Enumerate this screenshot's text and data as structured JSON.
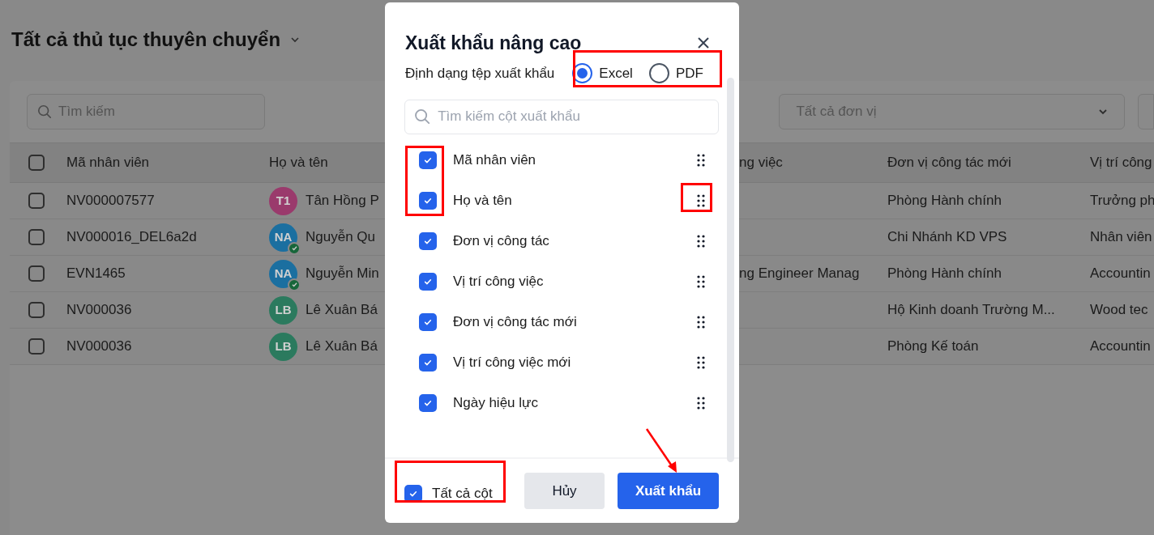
{
  "page": {
    "title": "Tất cả thủ tục thuyên chuyển",
    "search": {
      "placeholder": "Tìm kiếm"
    },
    "unit_filter": {
      "placeholder": "Tất cả đơn vị"
    }
  },
  "table": {
    "header_checked": false,
    "columns": [
      "Mã nhân viên",
      "Họ và tên",
      "ng việc",
      "Đơn vị công tác mới",
      "Vị trí công"
    ],
    "rows": [
      {
        "checked": false,
        "code": "NV000007577",
        "avatar": {
          "initials": "T1",
          "color": "#9a3a6c",
          "verified": false
        },
        "name": "Tân Hồng P",
        "column_3": "",
        "new_unit": "Phòng Hành chính",
        "column_5": "Trưởng ph"
      },
      {
        "checked": false,
        "code": "NV000016_DEL6a2d",
        "avatar": {
          "initials": "NA",
          "color": "#1b6fa0",
          "verified": true
        },
        "name": "Nguyễn Qu",
        "column_3": "",
        "new_unit": "Chi Nhánh KD VPS",
        "column_5": "Nhân viên"
      },
      {
        "checked": false,
        "code": "EVN1465",
        "avatar": {
          "initials": "NA",
          "color": "#1b6fa0",
          "verified": true
        },
        "name": "Nguyễn Min",
        "column_3": "ng Engineer Manag",
        "new_unit": "Phòng Hành chính",
        "column_5": "Accountin"
      },
      {
        "checked": false,
        "code": "NV000036",
        "avatar": {
          "initials": "LB",
          "color": "#2b7a5e",
          "verified": false
        },
        "name": "Lê Xuân Bá",
        "column_3": "",
        "new_unit": "Hộ Kinh doanh Trường M...",
        "column_5": "Wood tec"
      },
      {
        "checked": false,
        "code": "NV000036",
        "avatar": {
          "initials": "LB",
          "color": "#2b7a5e",
          "verified": false
        },
        "name": "Lê Xuân Bá",
        "column_3": "",
        "new_unit": "Phòng Kế toán",
        "column_5": "Accountin"
      }
    ]
  },
  "dialog": {
    "title": "Xuất khẩu nâng cao",
    "format_label": "Định dạng tệp xuất khẩu",
    "formats": [
      {
        "label": "Excel",
        "selected": true
      },
      {
        "label": "PDF",
        "selected": false
      }
    ],
    "search": {
      "placeholder": "Tìm kiếm cột xuất khẩu"
    },
    "columns": [
      {
        "label": "Mã nhân viên",
        "checked": true
      },
      {
        "label": "Họ và tên",
        "checked": true
      },
      {
        "label": "Đơn vị công tác",
        "checked": true
      },
      {
        "label": "Vị trí công việc",
        "checked": true
      },
      {
        "label": "Đơn vị công tác mới",
        "checked": true
      },
      {
        "label": "Vị trí công việc mới",
        "checked": true
      },
      {
        "label": "Ngày hiệu lực",
        "checked": true
      }
    ],
    "all_columns": {
      "label": "Tất cả cột",
      "checked": true
    },
    "buttons": [
      {
        "label": "Hủy",
        "kind": "secondary"
      },
      {
        "label": "Xuất khẩu",
        "kind": "primary"
      }
    ]
  }
}
